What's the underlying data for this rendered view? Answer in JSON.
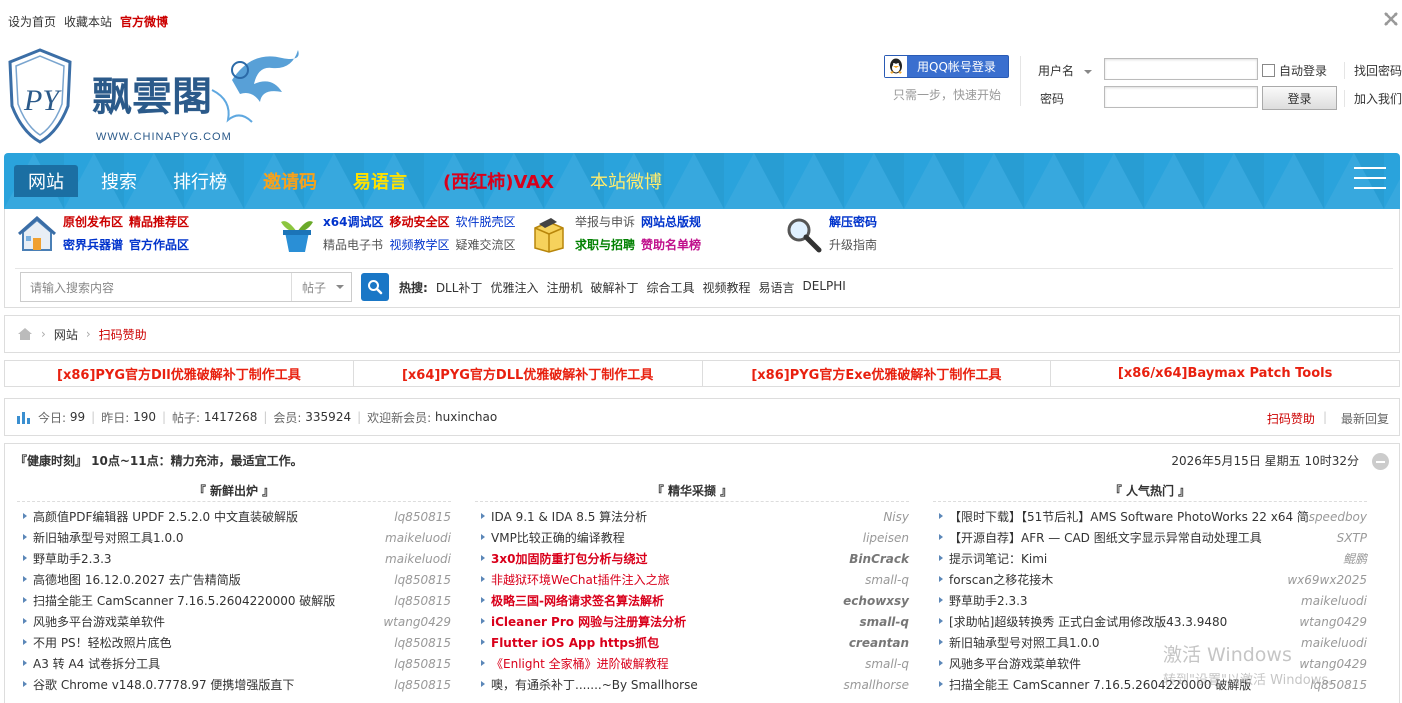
{
  "topbar": {
    "set_home": "设为首页",
    "bookmark": "收藏本站",
    "weibo": "官方微博"
  },
  "logo": {
    "title": "飘雲閣",
    "url_text": "WWW.CHINAPYG.COM",
    "mark": "PY"
  },
  "login": {
    "qq_button": "用QQ帐号登录",
    "qq_note": "只需一步，快速开始",
    "username_label": "用户名",
    "password_label": "密码",
    "auto_login": "自动登录",
    "login_button": "登录",
    "find_password": "找回密码",
    "join": "加入我们"
  },
  "nav": {
    "items": [
      {
        "label": "网站"
      },
      {
        "label": "搜索"
      },
      {
        "label": "排行榜"
      },
      {
        "label": "邀请码"
      },
      {
        "label": "易语言"
      },
      {
        "label": "(西红柿)VAX"
      },
      {
        "label": "本站微博"
      }
    ]
  },
  "quicknav": {
    "g1": [
      "原创发布区",
      "精品推荐区",
      "密界兵器谱",
      "官方作品区"
    ],
    "g2": [
      "x64调试区",
      "移动安全区",
      "软件脱壳区",
      "精品电子书",
      "视频教学区",
      "疑难交流区"
    ],
    "g3": [
      "举报与申诉",
      "网站总版规",
      "求职与招聘",
      "赞助名单榜"
    ],
    "g4": [
      "解压密码",
      "升级指南"
    ]
  },
  "search": {
    "placeholder": "请输入搜索内容",
    "type": "帖子",
    "hot_label": "热搜:",
    "hot": [
      "DLL补丁",
      "优雅注入",
      "注册机",
      "破解补丁",
      "综合工具",
      "视频教程",
      "易语言",
      "DELPHI"
    ]
  },
  "breadcrumb": {
    "home": "网站",
    "current": "扫码赞助"
  },
  "top_links": [
    "[x86]PYG官方Dll优雅破解补丁制作工具",
    "[x64]PYG官方DLL优雅破解补丁制作工具",
    "[x86]PYG官方Exe优雅破解补丁制作工具",
    "[x86/x64]Baymax Patch Tools"
  ],
  "stats": {
    "today_label": "今日:",
    "today": "99",
    "yesterday_label": "昨日:",
    "yesterday": "190",
    "posts_label": "帖子:",
    "posts": "1417268",
    "members_label": "会员:",
    "members": "335924",
    "newest_label": "欢迎新会员:",
    "newest": "huxinchao",
    "scan": "扫码赞助",
    "latest": "最新回复"
  },
  "panel": {
    "header": "『健康时刻』 10点~11点：精力充沛，最适宜工作。",
    "datetime": "2026年5月15日 星期五 10时32分",
    "columns": [
      {
        "title": "『 新鲜出炉 』",
        "rows": [
          {
            "t": "高颜值PDF编辑器 UPDF 2.5.2.0 中文直装破解版",
            "u": "lq850815"
          },
          {
            "t": "新旧轴承型号对照工具1.0.0",
            "u": "maikeluodi"
          },
          {
            "t": "野草助手2.3.3",
            "u": "maikeluodi"
          },
          {
            "t": "高德地图 16.12.0.2027 去广告精简版",
            "u": "lq850815"
          },
          {
            "t": "扫描全能王 CamScanner 7.16.5.2604220000 破解版",
            "u": "lq850815"
          },
          {
            "t": "风驰多平台游戏菜单软件",
            "u": "wtang0429"
          },
          {
            "t": "不用 PS！轻松改照片底色",
            "u": "lq850815"
          },
          {
            "t": "A3 转 A4 试卷拆分工具",
            "u": "lq850815"
          },
          {
            "t": "谷歌 Chrome v148.0.7778.97 便携增强版直下",
            "u": "lq850815"
          }
        ]
      },
      {
        "title": "『 精华采撷 』",
        "rows": [
          {
            "t": "IDA 9.1 & IDA 8.5 算法分析",
            "u": "Nisy"
          },
          {
            "t": "VMP比较正确的编译教程",
            "u": "lipeisen"
          },
          {
            "t": "3x0加固防重打包分析与绕过",
            "u": "BinCrack"
          },
          {
            "t": "非越狱环境WeChat插件注入之旅",
            "u": "small-q"
          },
          {
            "t": "极略三国-网络请求签名算法解析",
            "u": "echowxsy"
          },
          {
            "t": "iCleaner Pro 网验与注册算法分析",
            "u": "small-q"
          },
          {
            "t": "Flutter iOS App https抓包",
            "u": "creantan"
          },
          {
            "t": "《Enlight 全家桶》进阶破解教程",
            "u": "small-q"
          },
          {
            "t": "噢，有通杀补丁.......~By Smallhorse",
            "u": "smallhorse"
          }
        ]
      },
      {
        "title": "『 人气热门 』",
        "rows": [
          {
            "t": "【限时下载】【51节后礼】AMS Software PhotoWorks 22 x64 简体",
            "u": "speedboy"
          },
          {
            "t": "【开源自荐】AFR — CAD 图纸文字显示异常自动处理工具",
            "u": "SXTP"
          },
          {
            "t": "提示词笔记：Kimi",
            "u": "鲲鹏"
          },
          {
            "t": "forscan之移花接木",
            "u": "wx69wx2025"
          },
          {
            "t": "野草助手2.3.3",
            "u": "maikeluodi"
          },
          {
            "t": "[求助帖]超级转换秀 正式白金试用修改版43.3.9480",
            "u": "wtang0429"
          },
          {
            "t": "新旧轴承型号对照工具1.0.0",
            "u": "maikeluodi"
          },
          {
            "t": "风驰多平台游戏菜单软件",
            "u": "wtang0429"
          },
          {
            "t": "扫描全能王 CamScanner 7.16.5.2604220000 破解版",
            "u": "lq850815"
          }
        ]
      }
    ]
  },
  "watermark": {
    "line1": "激活 Windows",
    "line2": "转到\"设置\"以激活 Windows。"
  }
}
